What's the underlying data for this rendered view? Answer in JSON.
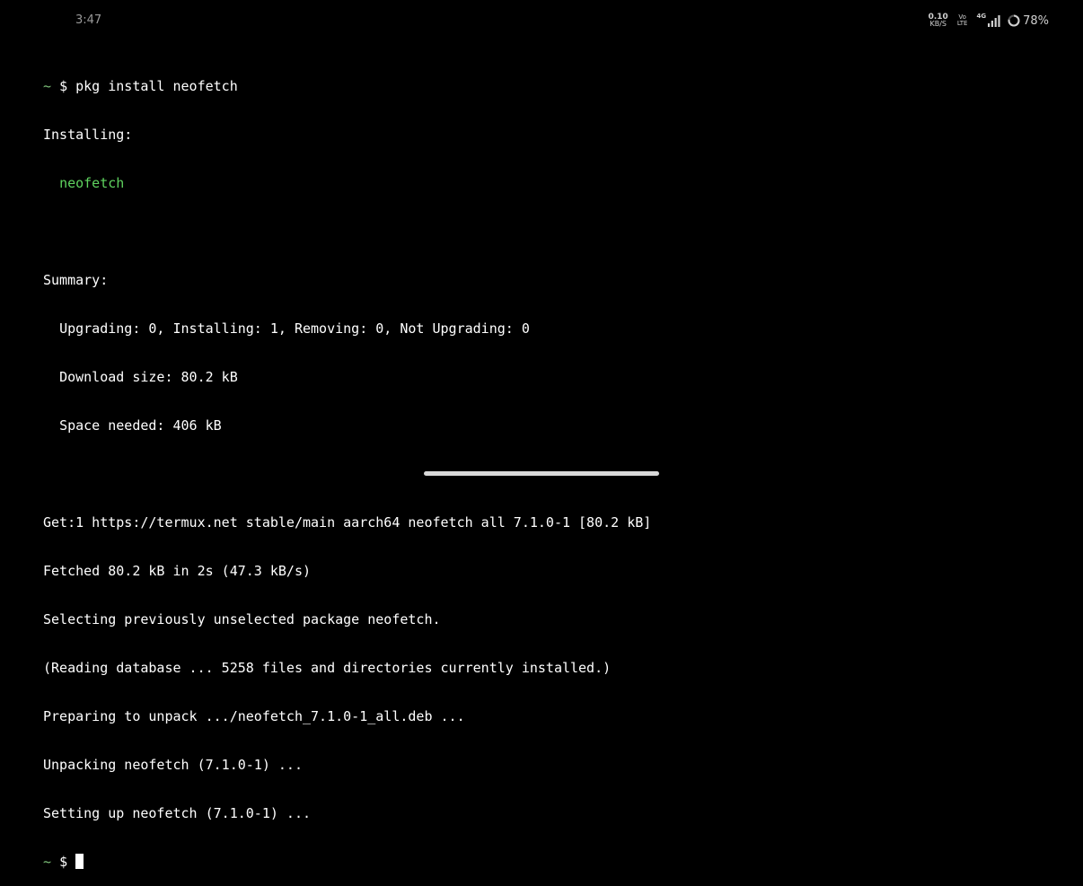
{
  "status_bar": {
    "time": "3:47",
    "net_speed_value": "0.10",
    "net_speed_unit": "KB/S",
    "volte_top": "Vo",
    "volte_bottom": "LTE",
    "network_type": "4G",
    "signal_icon": "signal-bars-icon",
    "battery_icon": "battery-ring-icon",
    "battery_percent": "78%",
    "battery_level": 0.78
  },
  "terminal": {
    "prompt_symbol": "~",
    "prompt_dollar": "$",
    "command": "pkg install neofetch",
    "installing_header": "Installing:",
    "installing_package": "neofetch",
    "summary_header": "Summary:",
    "summary_lines": [
      "Upgrading: 0, Installing: 1, Removing: 0, Not Upgrading: 0",
      "Download size: 80.2 kB",
      "Space needed: 406 kB"
    ],
    "output_lines": [
      "Get:1 https://termux.net stable/main aarch64 neofetch all 7.1.0-1 [80.2 kB]",
      "Fetched 80.2 kB in 2s (47.3 kB/s)",
      "Selecting previously unselected package neofetch.",
      "(Reading database ... 5258 files and directories currently installed.)",
      "Preparing to unpack .../neofetch_7.1.0-1_all.deb ...",
      "Unpacking neofetch (7.1.0-1) ...",
      "Setting up neofetch (7.1.0-1) ..."
    ]
  },
  "colors": {
    "background": "#000000",
    "text": "#ffffff",
    "prompt_green": "#7ec27a",
    "package_green": "#5fd35f"
  }
}
